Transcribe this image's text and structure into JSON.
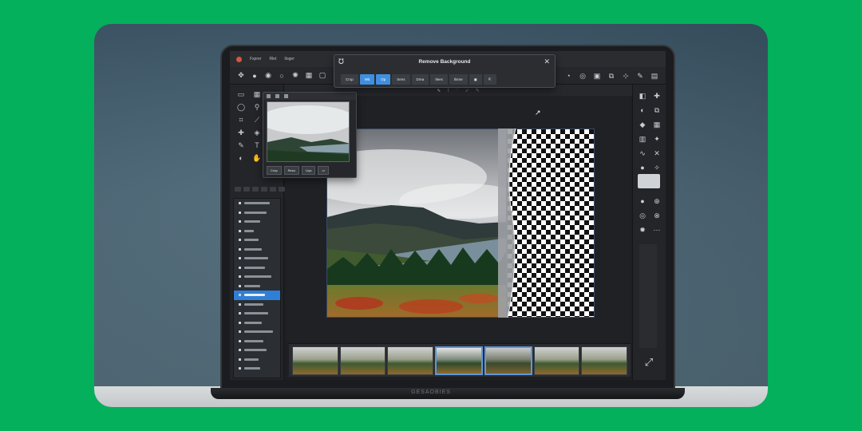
{
  "dialog": {
    "title": "Remove Background",
    "buttons": [
      "Crop",
      "Wit",
      "Op",
      "Sens",
      "Drea",
      "Ilees",
      "Ilsme"
    ]
  },
  "menubar": {
    "items": [
      "Fxprer",
      "Rlet",
      "Iloger"
    ]
  },
  "preview": {
    "buttons": [
      "Crop",
      "Reso",
      "Ltys"
    ]
  },
  "laptop": {
    "brand": "GESAOBIES"
  },
  "layers": {
    "active_index": 10,
    "count": 19
  },
  "colors": {
    "background": "#04b05c",
    "accent": "#3f8fe0",
    "app_bg": "#1d1f22"
  }
}
